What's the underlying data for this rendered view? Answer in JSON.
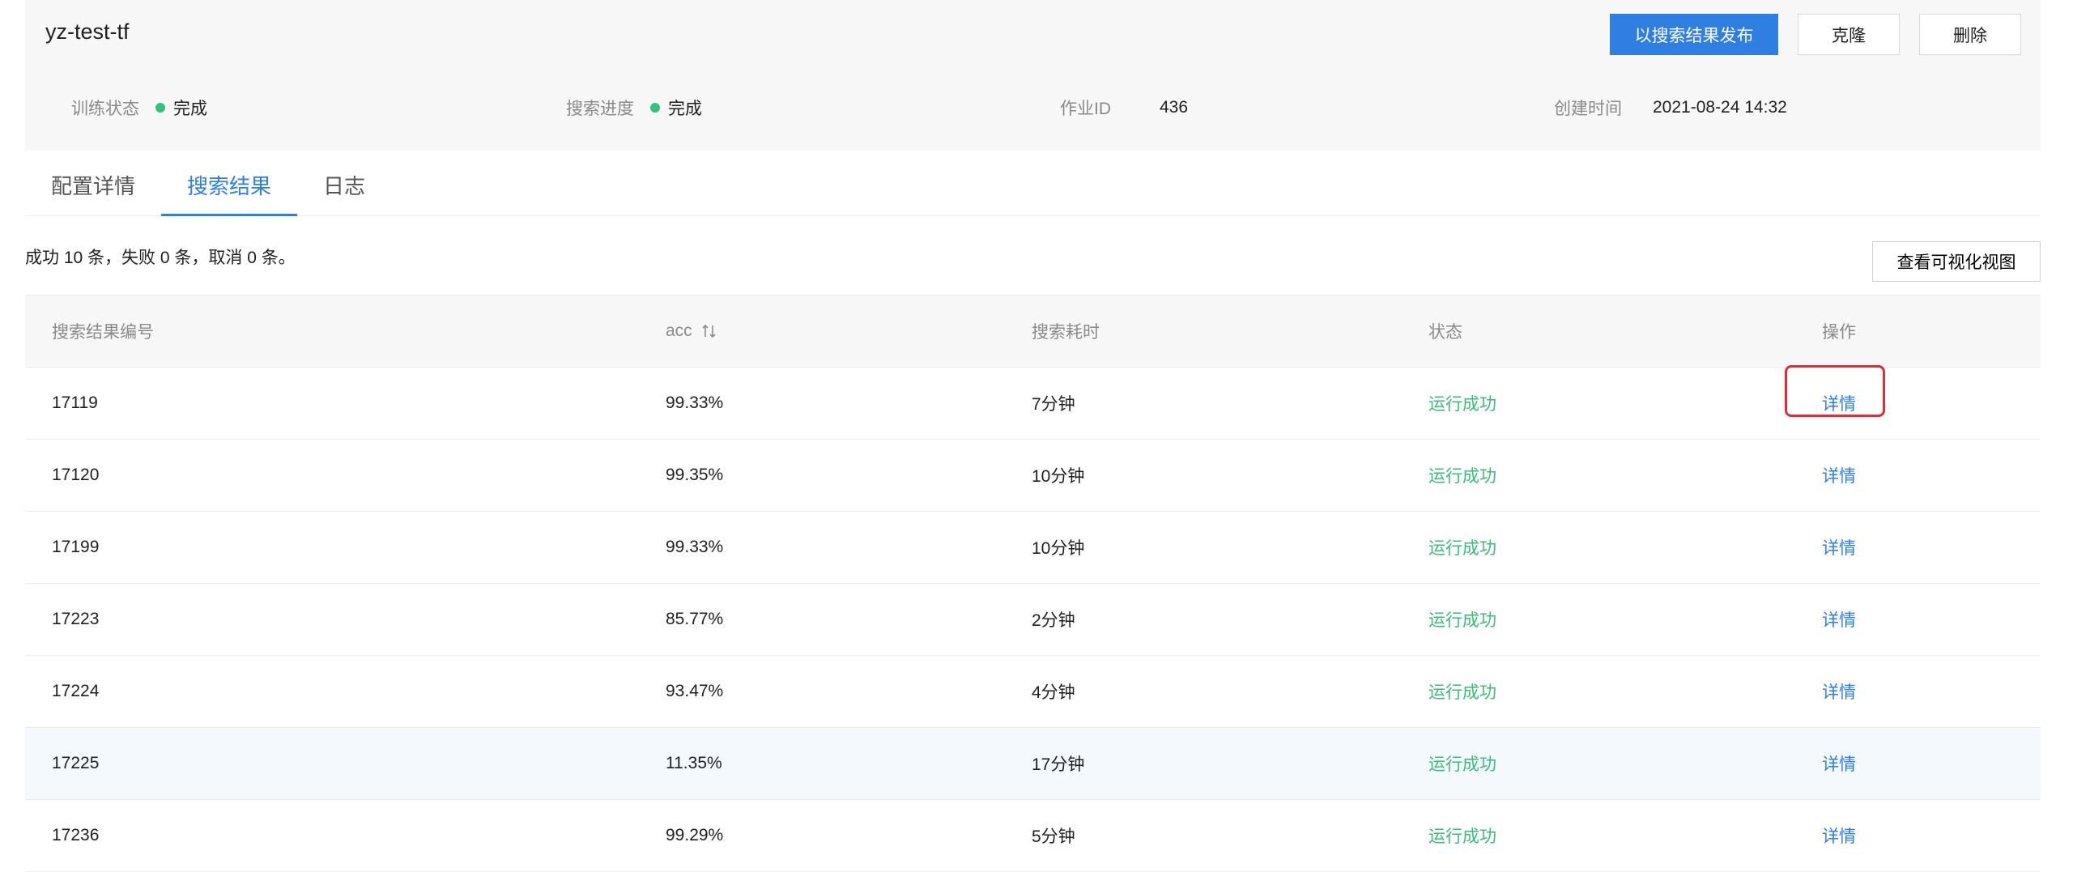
{
  "header": {
    "job_name": "yz-test-tf",
    "actions": {
      "publish": "以搜索结果发布",
      "clone": "克隆",
      "delete": "删除"
    },
    "meta": {
      "train_status": {
        "label": "训练状态",
        "value": "完成"
      },
      "search_progress": {
        "label": "搜索进度",
        "value": "完成"
      },
      "job_id": {
        "label": "作业ID",
        "value": "436"
      },
      "created_at": {
        "label": "创建时间",
        "value": "2021-08-24 14:32"
      }
    }
  },
  "tabs": [
    {
      "label": "配置详情",
      "active": false
    },
    {
      "label": "搜索结果",
      "active": true
    },
    {
      "label": "日志",
      "active": false
    }
  ],
  "summary": "成功 10 条，失败 0 条，取消 0 条。",
  "viz_button": "查看可视化视图",
  "table": {
    "columns": [
      "搜索结果编号",
      "acc",
      "搜索耗时",
      "状态",
      "操作"
    ],
    "rows": [
      {
        "id": "17119",
        "acc": "99.33%",
        "time": "7分钟",
        "status": "运行成功",
        "action": "详情"
      },
      {
        "id": "17120",
        "acc": "99.35%",
        "time": "10分钟",
        "status": "运行成功",
        "action": "详情"
      },
      {
        "id": "17199",
        "acc": "99.33%",
        "time": "10分钟",
        "status": "运行成功",
        "action": "详情"
      },
      {
        "id": "17223",
        "acc": "85.77%",
        "time": "2分钟",
        "status": "运行成功",
        "action": "详情"
      },
      {
        "id": "17224",
        "acc": "93.47%",
        "time": "4分钟",
        "status": "运行成功",
        "action": "详情"
      },
      {
        "id": "17225",
        "acc": "11.35%",
        "time": "17分钟",
        "status": "运行成功",
        "action": "详情"
      },
      {
        "id": "17236",
        "acc": "99.29%",
        "time": "5分钟",
        "status": "运行成功",
        "action": "详情"
      }
    ],
    "hovered_row": 5,
    "annotated_row": 0
  },
  "colors": {
    "primary": "#2f7fe3",
    "success": "#3dbb7a",
    "status_dot": "#34c27a",
    "annotation": "#e02b3a"
  },
  "icons": {
    "status": "status-dot-icon",
    "sort": "sort-arrows-icon"
  }
}
